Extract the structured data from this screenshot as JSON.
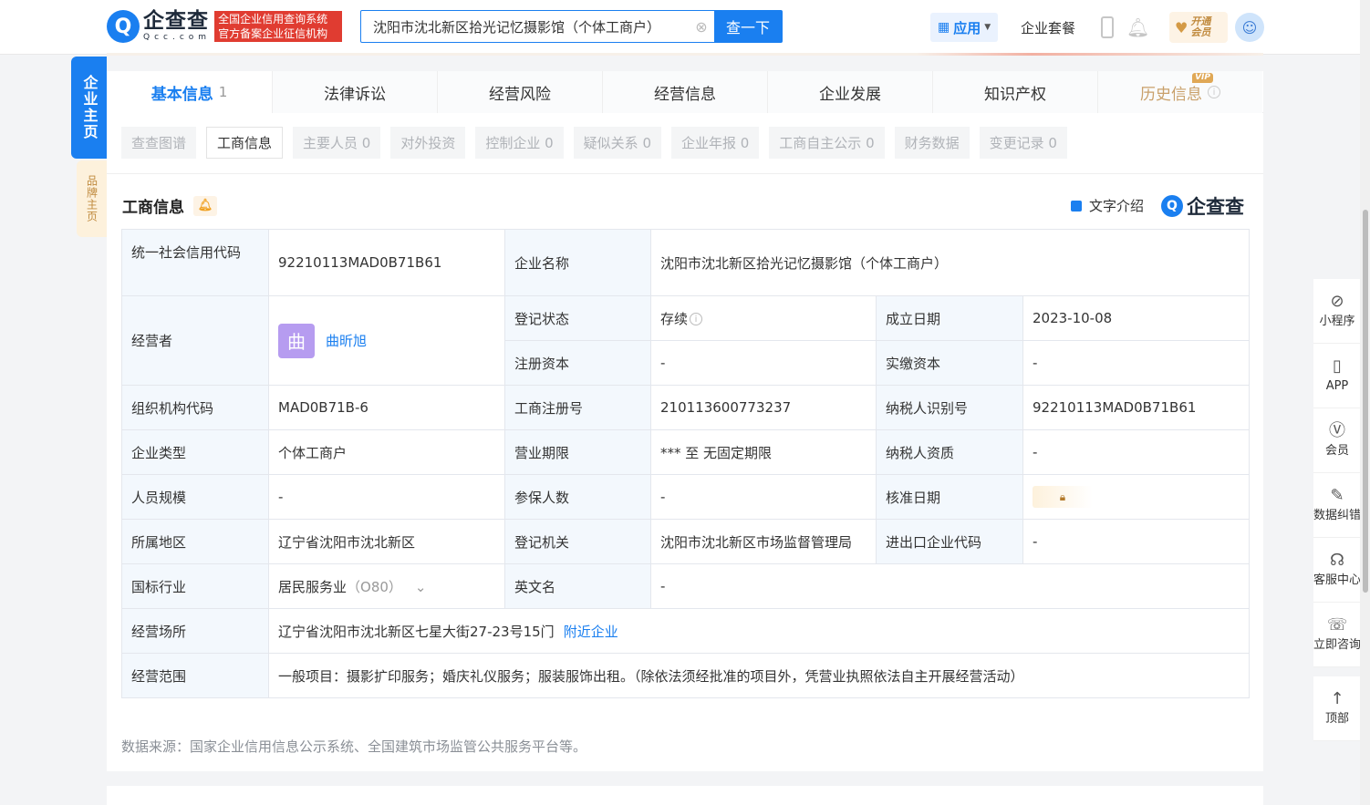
{
  "header": {
    "logo_cn": "企查查",
    "logo_en": "Qcc.com",
    "slogan": "全国企业信用查询系统 官方备案企业征信机构",
    "search_value": "沈阳市沈北新区拾光记忆摄影馆（个体工商户）",
    "search_button": "查一下",
    "apps_label": "应用",
    "suite_label": "企业套餐",
    "vip_label_1": "开通",
    "vip_label_2": "会员"
  },
  "side_tabs": {
    "main": "企业主页",
    "brand": "品牌主页"
  },
  "tabs": [
    {
      "label": "基本信息",
      "count": "1"
    },
    {
      "label": "法律诉讼"
    },
    {
      "label": "经营风险"
    },
    {
      "label": "经营信息"
    },
    {
      "label": "企业发展"
    },
    {
      "label": "知识产权"
    },
    {
      "label": "历史信息",
      "badge": "VIP"
    }
  ],
  "subtabs": [
    "查查图谱",
    "工商信息",
    "主要人员 0",
    "对外投资",
    "控制企业 0",
    "疑似关系 0",
    "企业年报 0",
    "工商自主公示 0",
    "财务数据",
    "变更记录 0"
  ],
  "section": {
    "title": "工商信息",
    "text_intro": "文字介绍",
    "brand": "企查查"
  },
  "info": {
    "credit_code_label": "统一社会信用代码",
    "credit_code": "92210113MAD0B71B61",
    "company_name_label": "企业名称",
    "company_name": "沈阳市沈北新区拾光记忆摄影馆（个体工商户）",
    "operator_label": "经营者",
    "operator_avatar": "曲",
    "operator_name": "曲昕旭",
    "reg_status_label": "登记状态",
    "reg_status": "存续",
    "founded_label": "成立日期",
    "founded": "2023-10-08",
    "reg_capital_label": "注册资本",
    "reg_capital": "-",
    "paid_capital_label": "实缴资本",
    "paid_capital": "-",
    "org_code_label": "组织机构代码",
    "org_code": "MAD0B71B-6",
    "biz_reg_no_label": "工商注册号",
    "biz_reg_no": "210113600773237",
    "taxpayer_id_label": "纳税人识别号",
    "taxpayer_id": "92210113MAD0B71B61",
    "type_label": "企业类型",
    "type": "个体工商户",
    "term_label": "营业期限",
    "term": "*** 至 无固定期限",
    "taxpayer_qual_label": "纳税人资质",
    "taxpayer_qual": "-",
    "staff_label": "人员规模",
    "staff": "-",
    "insured_label": "参保人数",
    "insured": "-",
    "approval_label": "核准日期",
    "region_label": "所属地区",
    "region": "辽宁省沈阳市沈北新区",
    "authority_label": "登记机关",
    "authority": "沈阳市沈北新区市场监督管理局",
    "ie_code_label": "进出口企业代码",
    "ie_code": "-",
    "industry_label": "国标行业",
    "industry": "居民服务业",
    "industry_code": "（O80）",
    "english_label": "英文名",
    "english": "-",
    "address_label": "经营场所",
    "address": "辽宁省沈阳市沈北新区七星大街27-23号15门",
    "nearby": "附近企业",
    "scope_label": "经营范围",
    "scope": "一般项目：摄影扩印服务；婚庆礼仪服务；服装服饰出租。（除依法须经批准的项目外，凭营业执照依法自主开展经营活动）"
  },
  "source": "数据来源：国家企业信用信息公示系统、全国建筑市场监管公共服务平台等。",
  "float_bar": [
    "小程序",
    "APP",
    "会员",
    "数据纠错",
    "客服中心",
    "立即咨询",
    "顶部"
  ]
}
